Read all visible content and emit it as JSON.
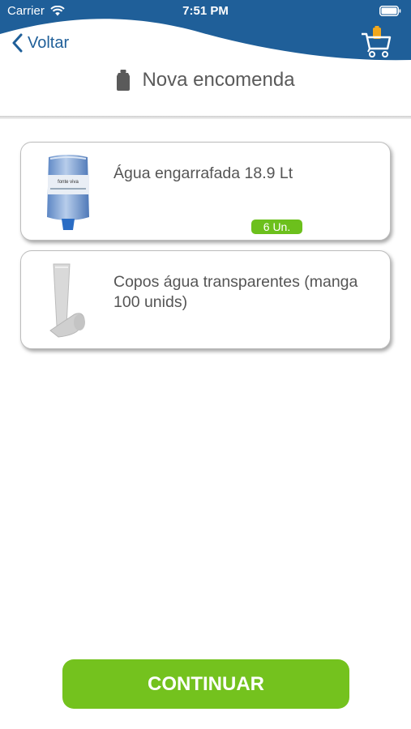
{
  "status_bar": {
    "carrier": "Carrier",
    "time": "7:51 PM"
  },
  "nav": {
    "back_label": "Voltar",
    "title": "Nova encomenda"
  },
  "products": [
    {
      "name": "Água engarrafada 18.9 Lt",
      "quantity": "6 Un.",
      "image_brand": "fonte viva"
    },
    {
      "name": "Copos água transparentes (manga 100 unids)"
    }
  ],
  "actions": {
    "continue_label": "CONTINUAR"
  },
  "colors": {
    "header_blue": "#1f5f99",
    "accent_green": "#74c21e",
    "badge_green": "#6cc01c",
    "cart_bag_orange": "#f2a81d"
  },
  "icons": {
    "back": "chevron-left-icon",
    "cart": "shopping-cart-icon",
    "title": "bottle-icon",
    "wifi": "wifi-icon",
    "battery": "battery-icon"
  }
}
